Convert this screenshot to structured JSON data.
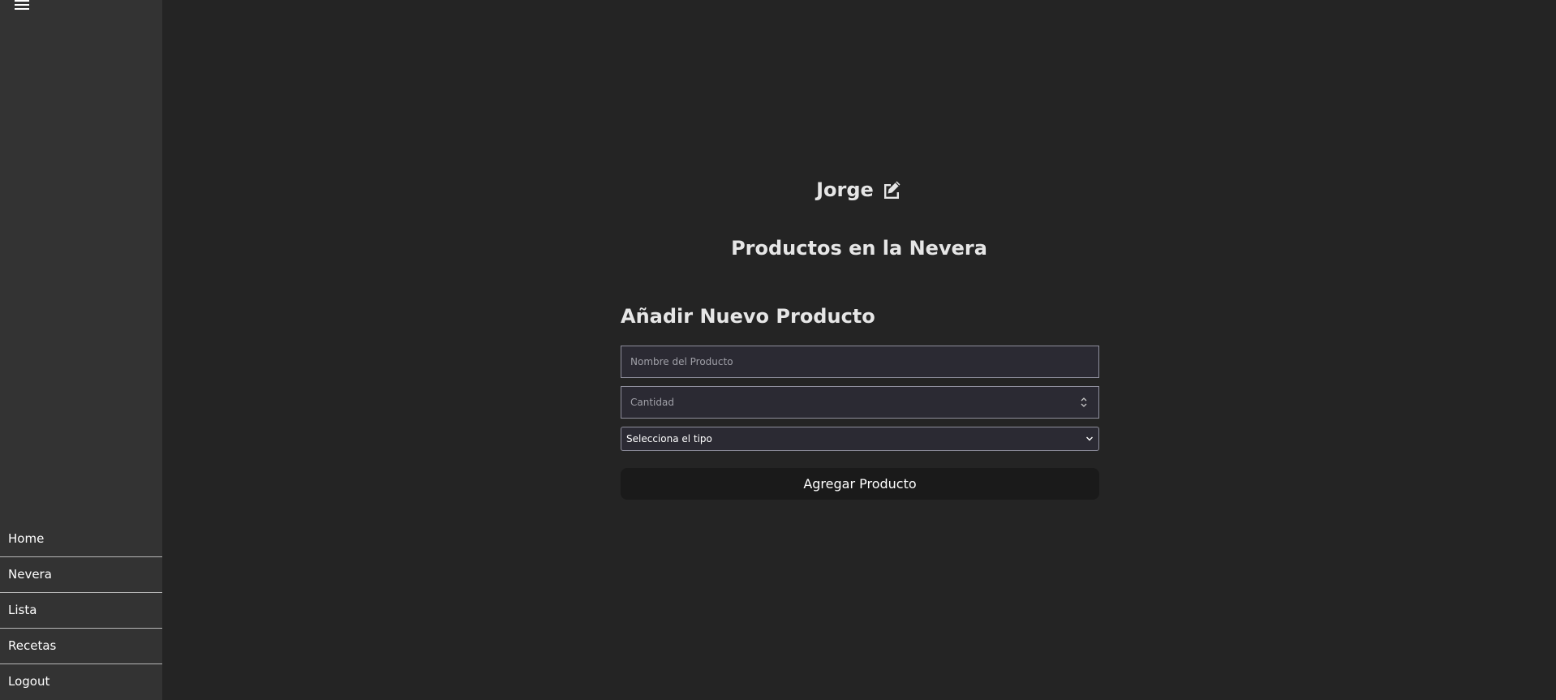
{
  "sidebar": {
    "menu_icon": "hamburger-icon",
    "items": [
      {
        "label": "Home"
      },
      {
        "label": "Nevera"
      },
      {
        "label": "Lista"
      },
      {
        "label": "Recetas"
      },
      {
        "label": "Logout"
      }
    ]
  },
  "header": {
    "user_name": "Jorge",
    "edit_icon": "edit-icon",
    "section_title": "Productos en la Nevera"
  },
  "form": {
    "title": "Añadir Nuevo Producto",
    "product_name_placeholder": "Nombre del Producto",
    "product_name_value": "",
    "quantity_placeholder": "Cantidad",
    "quantity_value": "",
    "type_selected": "Selecciona el tipo",
    "submit_label": "Agregar Producto"
  },
  "colors": {
    "background": "#242424",
    "sidebar": "#333333",
    "input_background": "#2b2a33",
    "button_background": "#1a1a1a",
    "text": "#ffffff"
  }
}
